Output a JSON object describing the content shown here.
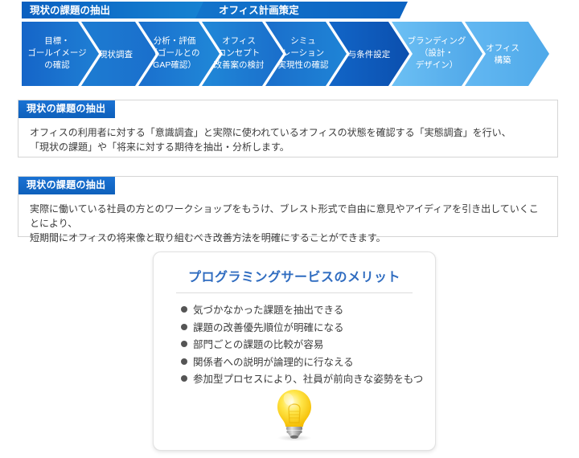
{
  "flow": {
    "banners": [
      {
        "label": "現状の課題の抽出"
      },
      {
        "label": "オフィス計画策定"
      }
    ],
    "steps": [
      {
        "lines": [
          "目標・",
          "ゴールイメージ",
          "の確認"
        ]
      },
      {
        "lines": [
          "現状調査"
        ]
      },
      {
        "lines": [
          "分析・評価",
          "（ゴールとの",
          "GAP確認）"
        ]
      },
      {
        "lines": [
          "オフィス",
          "コンセプト",
          "改善案の検討"
        ]
      },
      {
        "lines": [
          "シミュ",
          "レーション",
          "実現性の確認"
        ]
      },
      {
        "lines": [
          "与条件設定"
        ]
      },
      {
        "lines": [
          "ブランディング",
          "（設計・",
          "デザイン）"
        ]
      },
      {
        "lines": [
          "オフィス",
          "構築"
        ]
      }
    ],
    "colors": {
      "banner_dark": "#0b63c4",
      "banner_mid": "#1f8fd8",
      "step_dark": "#0f63c9",
      "step_light": "#5fb4ef",
      "step_lightest": "#63b6ef"
    }
  },
  "boxes": [
    {
      "header": "現状の課題の抽出",
      "lines": [
        "オフィスの利用者に対する「意識調査」と実際に使われているオフィスの状態を確認する「実態調査」を行い、",
        "「現状の課題」や「将来に対する期待を抽出・分析します。"
      ]
    },
    {
      "header": "現状の課題の抽出",
      "lines": [
        "実際に働いている社員の方とのワークショップをもうけ、ブレスト形式で自由に意見やアイディアを引き出していくことにより、",
        "短期間にオフィスの将来像と取り組むべき改善方法を明確にすることができます。"
      ]
    }
  ],
  "merit_card": {
    "title": "プログラミングサービスのメリット",
    "title_color": "#2f6cc0",
    "items": [
      "気づかなかった課題を抽出できる",
      "課題の改善優先順位が明確になる",
      "部門ごとの課題の比較が容易",
      "関係者への説明が論理的に行なえる",
      "参加型プロセスにより、社員が前向きな姿勢をもつ"
    ],
    "icon": "lightbulb-icon"
  }
}
